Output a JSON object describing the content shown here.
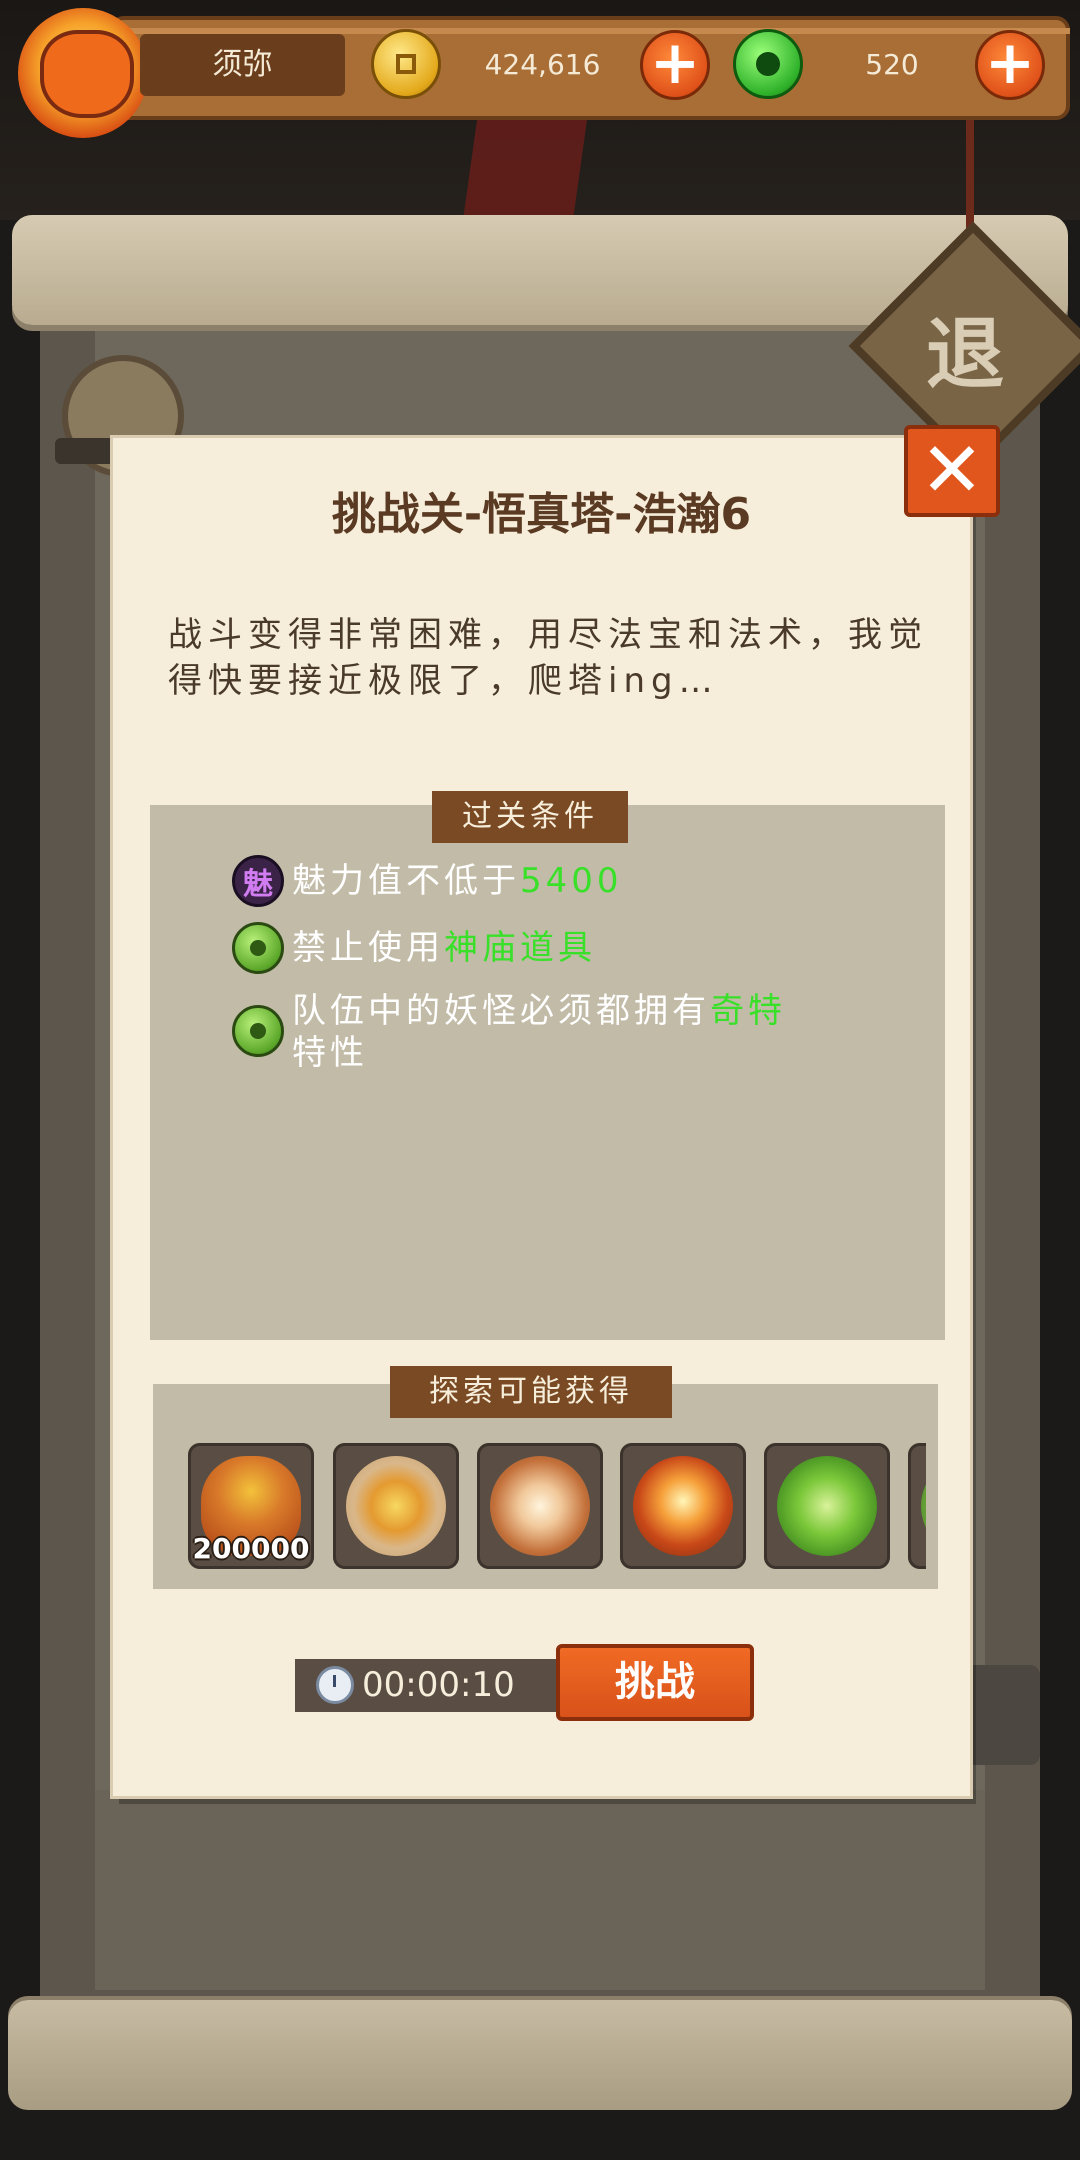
{
  "topbar": {
    "player_name": "须弥",
    "gold_amount": "424,616",
    "jade_amount": "520",
    "avatar_icon": "fox-mask-avatar",
    "gold_icon": "gold-coin-icon",
    "jade_icon": "jade-coin-icon",
    "plus_icon": "plus-icon"
  },
  "background": {
    "retreat_label": "退"
  },
  "dialog": {
    "title": "挑战关-悟真塔-浩瀚6",
    "description": "战斗变得非常困难，用尽法宝和法术，我觉得快要接近极限了，爬塔ing…",
    "close_icon": "close-icon",
    "conditions_header": "过关条件",
    "charm_icon_glyph": "魅",
    "conditions": [
      {
        "prefix": "魅力值不低于",
        "highlight": "5400",
        "suffix": ""
      },
      {
        "prefix": "禁止使用",
        "highlight": "神庙道具",
        "suffix": ""
      },
      {
        "prefix": "队伍中的妖怪必须都拥有",
        "highlight": "奇特",
        "suffix": "特性"
      }
    ],
    "rewards_header": "探索可能获得",
    "rewards": [
      {
        "icon": "gold-bag-icon",
        "quantity": "200000"
      },
      {
        "icon": "compass-orb-icon",
        "quantity": ""
      },
      {
        "icon": "swirl-orb-icon",
        "quantity": ""
      },
      {
        "icon": "fire-orb-icon",
        "quantity": ""
      },
      {
        "icon": "jade-orb-icon",
        "quantity": ""
      },
      {
        "icon": "green-orb-icon",
        "quantity": ""
      }
    ],
    "timer": "00:00:10",
    "timer_icon": "stopwatch-icon",
    "challenge_button": "挑战"
  },
  "colors": {
    "highlight_green": "#39e029",
    "button_orange": "#e0561c",
    "panel_bg": "#f6eedb",
    "header_brown": "#7a4a24"
  }
}
